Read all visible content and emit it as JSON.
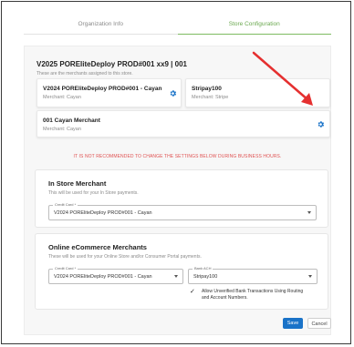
{
  "tabs": [
    {
      "label": "Organization Info"
    },
    {
      "label": "Store Configuration"
    }
  ],
  "store": {
    "title": "V2025 POREliteDeploy PROD#001 xx9 | 001",
    "subtitle": "These are the merchants assigned to this store."
  },
  "merchant_cards": [
    {
      "name": "V2024 POREliteDeploy PROD#001 - Cayan",
      "subtitle": "Merchant: Cayan"
    },
    {
      "name": "Stripay100",
      "subtitle": "Merchant: Stripe"
    },
    {
      "name": "001 Cayan Merchant",
      "subtitle": "Merchant: Cayan"
    }
  ],
  "warning": "IT IS NOT RECOMMENDED TO CHANGE THE SETTINGS BELOW DURING BUSINESS HOURS.",
  "in_store": {
    "title": "In Store Merchant",
    "subtitle": "This will be used for your In Store payments.",
    "credit_card_label": "Credit Card *",
    "credit_card_value": "V2024 POREliteDeploy PROD#001 - Cayan"
  },
  "online": {
    "title": "Online eCommerce Merchants",
    "subtitle": "These will be used for your Online Store and/or Consumer Portal payments.",
    "credit_card_label": "Credit Card *",
    "credit_card_value": "V2024 POREliteDeploy PROD#001 - Cayan",
    "bank_label": "Bank ACH",
    "bank_value": "Stripay100",
    "checkbox_label_1": "Allow Unverified Bank Transactions Using Routing",
    "checkbox_label_2": "and Account Numbers.",
    "checkbox_checked": true
  },
  "actions": {
    "save": "Save",
    "cancel": "Cancel"
  },
  "colors": {
    "accent_tab": "#7dbb61",
    "primary_button": "#1a73c8",
    "gear": "#1a73c8",
    "warning": "#e05252",
    "annotation_arrow": "#e53030"
  }
}
